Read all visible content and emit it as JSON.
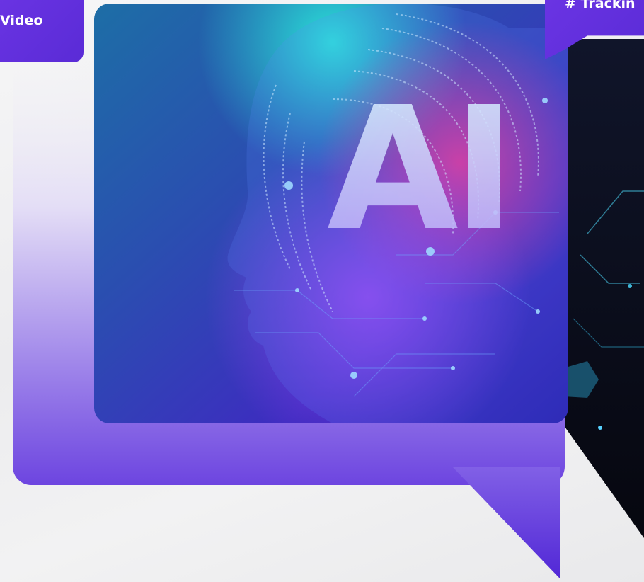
{
  "tags": {
    "left_label": "Video",
    "right_label": "# Trackin"
  },
  "hero": {
    "headline_text": "AI"
  },
  "colors": {
    "accent_purple": "#5b2ed8",
    "bubble_light": "#b9a6ee",
    "panel_dark": "#0c0f22"
  }
}
